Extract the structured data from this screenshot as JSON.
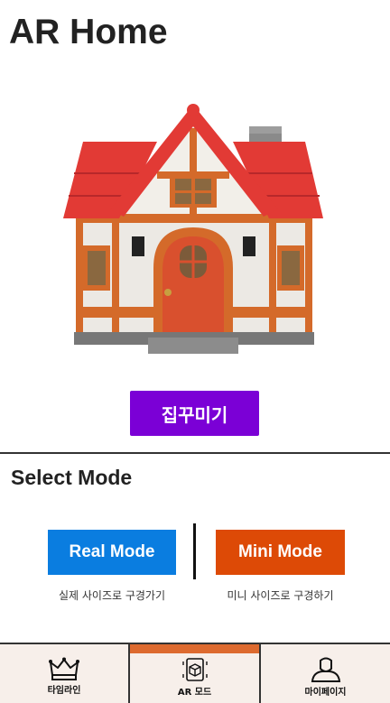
{
  "header": {
    "title": "AR Home"
  },
  "main": {
    "decorate_label": "집꾸미기",
    "section_title": "Select Mode",
    "modes": [
      {
        "label": "Real Mode",
        "description": "실제 사이즈로 구경가기",
        "color": "#0a7de0"
      },
      {
        "label": "Mini Mode",
        "description": "미니 사이즈로 구경하기",
        "color": "#dd4a06"
      }
    ]
  },
  "tabbar": {
    "active_index": 1,
    "tabs": [
      {
        "label": "타임라인",
        "icon": "crown-icon"
      },
      {
        "label": "AR 모드",
        "icon": "ar-cube-icon"
      },
      {
        "label": "마이페이지",
        "icon": "user-icon"
      }
    ]
  },
  "colors": {
    "accent_purple": "#7b00d6",
    "active_tab": "#dd6a2f"
  }
}
